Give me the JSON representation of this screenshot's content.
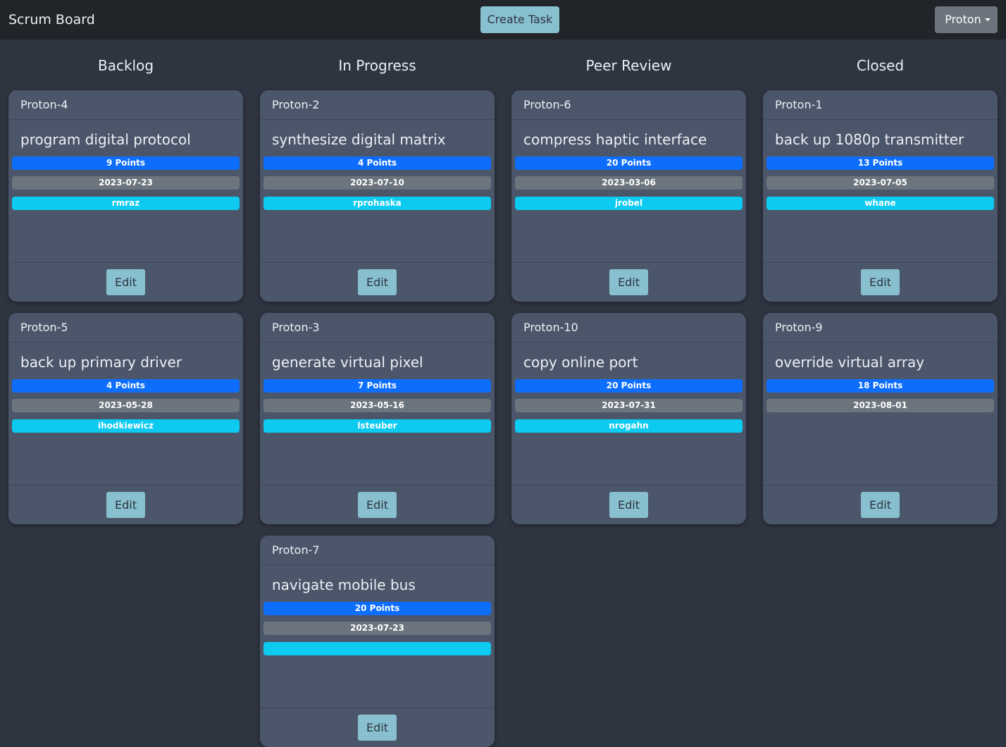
{
  "navbar": {
    "brand": "Scrum Board",
    "create_label": "Create Task",
    "user_label": "Proton"
  },
  "columns": [
    {
      "title": "Backlog",
      "cards": [
        {
          "key": "Proton-4",
          "title": "program digital protocol",
          "points": "9 Points",
          "date": "2023-07-23",
          "assignee": "rmraz",
          "edit": "Edit"
        },
        {
          "key": "Proton-5",
          "title": "back up primary driver",
          "points": "4 Points",
          "date": "2023-05-28",
          "assignee": "ihodkiewicz",
          "edit": "Edit"
        }
      ]
    },
    {
      "title": "In Progress",
      "cards": [
        {
          "key": "Proton-2",
          "title": "synthesize digital matrix",
          "points": "4 Points",
          "date": "2023-07-10",
          "assignee": "rprohaska",
          "edit": "Edit"
        },
        {
          "key": "Proton-3",
          "title": "generate virtual pixel",
          "points": "7 Points",
          "date": "2023-05-16",
          "assignee": "lsteuber",
          "edit": "Edit"
        },
        {
          "key": "Proton-7",
          "title": "navigate mobile bus",
          "points": "20 Points",
          "date": "2023-07-23",
          "assignee": "",
          "edit": "Edit"
        }
      ]
    },
    {
      "title": "Peer Review",
      "cards": [
        {
          "key": "Proton-6",
          "title": "compress haptic interface",
          "points": "20 Points",
          "date": "2023-03-06",
          "assignee": "jrobel",
          "edit": "Edit"
        },
        {
          "key": "Proton-10",
          "title": "copy online port",
          "points": "20 Points",
          "date": "2023-07-31",
          "assignee": "nrogahn",
          "edit": "Edit"
        }
      ]
    },
    {
      "title": "Closed",
      "cards": [
        {
          "key": "Proton-1",
          "title": "back up 1080p transmitter",
          "points": "13 Points",
          "date": "2023-07-05",
          "assignee": "whane",
          "edit": "Edit"
        },
        {
          "key": "Proton-9",
          "title": "override virtual array",
          "points": "18 Points",
          "date": "2023-08-01",
          "assignee": null,
          "edit": "Edit"
        }
      ]
    }
  ],
  "colors": {
    "page_bg": "#2e3440",
    "navbar_bg": "#212529",
    "card_bg": "#4c566a",
    "accent": "#88c0d0",
    "points_badge": "#0d6efd",
    "date_badge": "#6c757d",
    "assignee_badge": "#0dcaf0"
  }
}
